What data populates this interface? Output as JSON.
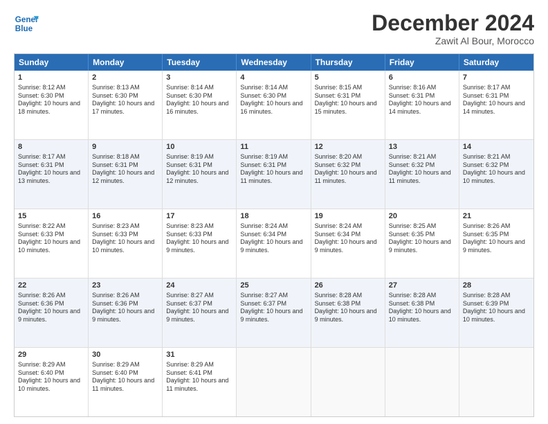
{
  "logo": {
    "line1": "General",
    "line2": "Blue"
  },
  "header": {
    "month": "December 2024",
    "location": "Zawit Al Bour, Morocco"
  },
  "weekdays": [
    "Sunday",
    "Monday",
    "Tuesday",
    "Wednesday",
    "Thursday",
    "Friday",
    "Saturday"
  ],
  "weeks": [
    {
      "alt": false,
      "cells": [
        {
          "day": "1",
          "sunrise": "8:12 AM",
          "sunset": "6:30 PM",
          "daylight": "10 hours and 18 minutes."
        },
        {
          "day": "2",
          "sunrise": "8:13 AM",
          "sunset": "6:30 PM",
          "daylight": "10 hours and 17 minutes."
        },
        {
          "day": "3",
          "sunrise": "8:14 AM",
          "sunset": "6:30 PM",
          "daylight": "10 hours and 16 minutes."
        },
        {
          "day": "4",
          "sunrise": "8:14 AM",
          "sunset": "6:30 PM",
          "daylight": "10 hours and 16 minutes."
        },
        {
          "day": "5",
          "sunrise": "8:15 AM",
          "sunset": "6:31 PM",
          "daylight": "10 hours and 15 minutes."
        },
        {
          "day": "6",
          "sunrise": "8:16 AM",
          "sunset": "6:31 PM",
          "daylight": "10 hours and 14 minutes."
        },
        {
          "day": "7",
          "sunrise": "8:17 AM",
          "sunset": "6:31 PM",
          "daylight": "10 hours and 14 minutes."
        }
      ]
    },
    {
      "alt": true,
      "cells": [
        {
          "day": "8",
          "sunrise": "8:17 AM",
          "sunset": "6:31 PM",
          "daylight": "10 hours and 13 minutes."
        },
        {
          "day": "9",
          "sunrise": "8:18 AM",
          "sunset": "6:31 PM",
          "daylight": "10 hours and 12 minutes."
        },
        {
          "day": "10",
          "sunrise": "8:19 AM",
          "sunset": "6:31 PM",
          "daylight": "10 hours and 12 minutes."
        },
        {
          "day": "11",
          "sunrise": "8:19 AM",
          "sunset": "6:31 PM",
          "daylight": "10 hours and 11 minutes."
        },
        {
          "day": "12",
          "sunrise": "8:20 AM",
          "sunset": "6:32 PM",
          "daylight": "10 hours and 11 minutes."
        },
        {
          "day": "13",
          "sunrise": "8:21 AM",
          "sunset": "6:32 PM",
          "daylight": "10 hours and 11 minutes."
        },
        {
          "day": "14",
          "sunrise": "8:21 AM",
          "sunset": "6:32 PM",
          "daylight": "10 hours and 10 minutes."
        }
      ]
    },
    {
      "alt": false,
      "cells": [
        {
          "day": "15",
          "sunrise": "8:22 AM",
          "sunset": "6:33 PM",
          "daylight": "10 hours and 10 minutes."
        },
        {
          "day": "16",
          "sunrise": "8:23 AM",
          "sunset": "6:33 PM",
          "daylight": "10 hours and 10 minutes."
        },
        {
          "day": "17",
          "sunrise": "8:23 AM",
          "sunset": "6:33 PM",
          "daylight": "10 hours and 9 minutes."
        },
        {
          "day": "18",
          "sunrise": "8:24 AM",
          "sunset": "6:34 PM",
          "daylight": "10 hours and 9 minutes."
        },
        {
          "day": "19",
          "sunrise": "8:24 AM",
          "sunset": "6:34 PM",
          "daylight": "10 hours and 9 minutes."
        },
        {
          "day": "20",
          "sunrise": "8:25 AM",
          "sunset": "6:35 PM",
          "daylight": "10 hours and 9 minutes."
        },
        {
          "day": "21",
          "sunrise": "8:26 AM",
          "sunset": "6:35 PM",
          "daylight": "10 hours and 9 minutes."
        }
      ]
    },
    {
      "alt": true,
      "cells": [
        {
          "day": "22",
          "sunrise": "8:26 AM",
          "sunset": "6:36 PM",
          "daylight": "10 hours and 9 minutes."
        },
        {
          "day": "23",
          "sunrise": "8:26 AM",
          "sunset": "6:36 PM",
          "daylight": "10 hours and 9 minutes."
        },
        {
          "day": "24",
          "sunrise": "8:27 AM",
          "sunset": "6:37 PM",
          "daylight": "10 hours and 9 minutes."
        },
        {
          "day": "25",
          "sunrise": "8:27 AM",
          "sunset": "6:37 PM",
          "daylight": "10 hours and 9 minutes."
        },
        {
          "day": "26",
          "sunrise": "8:28 AM",
          "sunset": "6:38 PM",
          "daylight": "10 hours and 9 minutes."
        },
        {
          "day": "27",
          "sunrise": "8:28 AM",
          "sunset": "6:38 PM",
          "daylight": "10 hours and 10 minutes."
        },
        {
          "day": "28",
          "sunrise": "8:28 AM",
          "sunset": "6:39 PM",
          "daylight": "10 hours and 10 minutes."
        }
      ]
    },
    {
      "alt": false,
      "cells": [
        {
          "day": "29",
          "sunrise": "8:29 AM",
          "sunset": "6:40 PM",
          "daylight": "10 hours and 10 minutes."
        },
        {
          "day": "30",
          "sunrise": "8:29 AM",
          "sunset": "6:40 PM",
          "daylight": "10 hours and 11 minutes."
        },
        {
          "day": "31",
          "sunrise": "8:29 AM",
          "sunset": "6:41 PM",
          "daylight": "10 hours and 11 minutes."
        },
        null,
        null,
        null,
        null
      ]
    }
  ]
}
